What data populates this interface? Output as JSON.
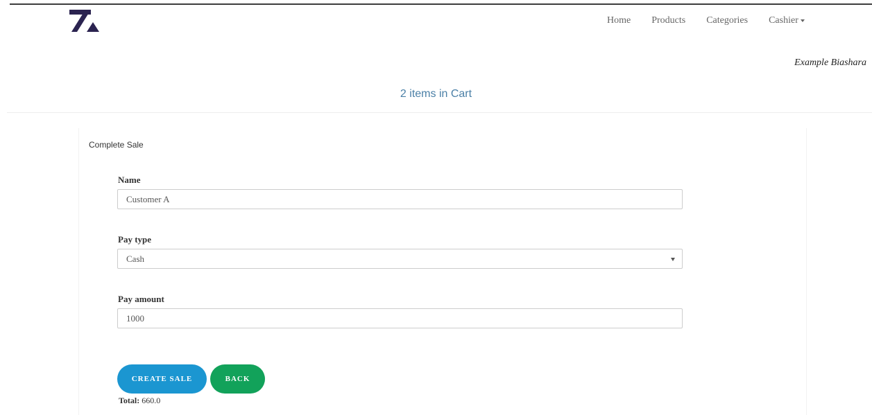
{
  "nav": {
    "items": [
      {
        "label": "Home"
      },
      {
        "label": "Products"
      },
      {
        "label": "Categories"
      },
      {
        "label": "Cashier"
      }
    ]
  },
  "business_name": "Example Biashara",
  "cart_status": "2 items in Cart",
  "form": {
    "title": "Complete Sale",
    "name_label": "Name",
    "name_value": "Customer A",
    "pay_type_label": "Pay type",
    "pay_type_value": "Cash",
    "pay_amount_label": "Pay amount",
    "pay_amount_value": "1000"
  },
  "buttons": {
    "create_sale": "CREATE SALE",
    "back": "BACK"
  },
  "total": {
    "label": "Total:",
    "value": "660.0"
  },
  "colors": {
    "logo": "#2b2350",
    "accent_blue": "#1b96d1",
    "accent_green": "#12a25a",
    "cart_text": "#4a7fa6"
  }
}
